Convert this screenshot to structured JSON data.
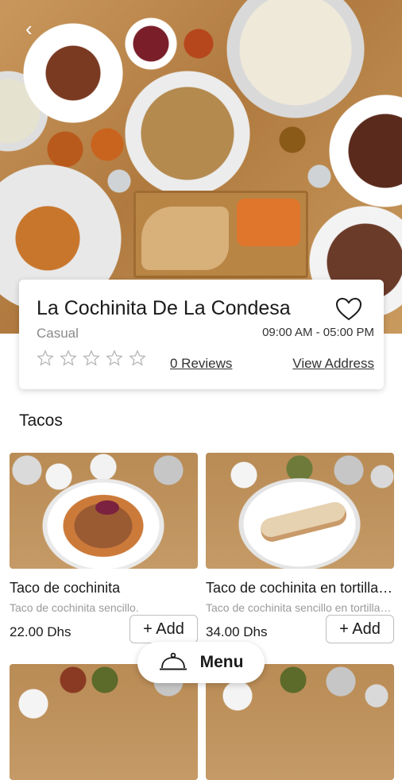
{
  "hero": {
    "back_icon": "arrow-left-icon"
  },
  "restaurant": {
    "name": "La Cochinita De La Condesa",
    "category": "Casual",
    "hours": "09:00 AM - 05:00 PM",
    "rating_stars": 0,
    "reviews_label": "0 Reviews",
    "address_label": "View Address",
    "favorite_icon": "heart-outline-icon"
  },
  "section": {
    "title": "Tacos"
  },
  "dishes": [
    {
      "name": "Taco de cochinita",
      "description": "Taco de cochinita sencillo.",
      "price": "22.00 Dhs",
      "add_label": "+ Add"
    },
    {
      "name": "Taco de cochinita en tortilla de harina",
      "description": "Taco de cochinita sencillo en tortilla de harina",
      "price": "34.00 Dhs",
      "add_label": "+ Add"
    },
    {
      "name": "",
      "description": "",
      "price": "",
      "add_label": ""
    },
    {
      "name": "",
      "description": "",
      "price": "",
      "add_label": ""
    }
  ],
  "menu_button": {
    "label": "Menu",
    "icon": "cloche-icon"
  }
}
